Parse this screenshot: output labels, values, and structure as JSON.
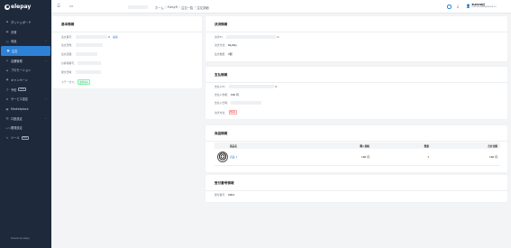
{
  "sidebar": {
    "logo_text": "elepay",
    "items": [
      {
        "icon": "dashboard-icon",
        "glyph": "⊞",
        "label": "ダッシュボード",
        "chevron": false,
        "beta": "",
        "active": false
      },
      {
        "icon": "payment-icon",
        "glyph": "▤",
        "label": "決済",
        "chevron": false,
        "beta": "",
        "active": false
      },
      {
        "icon": "product-icon",
        "glyph": "◫",
        "label": "商品",
        "chevron": true,
        "beta": "",
        "active": false
      },
      {
        "icon": "order-icon",
        "glyph": "▦",
        "label": "注文",
        "chevron": false,
        "beta": "",
        "active": true
      },
      {
        "icon": "store-icon",
        "glyph": "⌂",
        "label": "店舗管理",
        "chevron": true,
        "beta": "",
        "active": false
      },
      {
        "icon": "promotion-icon",
        "glyph": "◈",
        "label": "プロモーション",
        "chevron": false,
        "beta": "",
        "active": false
      },
      {
        "icon": "campaign-icon",
        "glyph": "◉",
        "label": "キャンペーン",
        "chevron": false,
        "beta": "",
        "active": false
      },
      {
        "icon": "booking-icon",
        "glyph": "◷",
        "label": "予約",
        "chevron": false,
        "beta": "Beta",
        "active": false
      },
      {
        "icon": "service-icon",
        "glyph": "⚙",
        "label": "サービス設定",
        "chevron": true,
        "beta": "",
        "active": false
      },
      {
        "icon": "marketplace-icon",
        "glyph": "▣",
        "label": "Marketplace",
        "chevron": false,
        "beta": "",
        "active": false
      },
      {
        "icon": "account-icon",
        "glyph": "▥",
        "label": "口座設定",
        "chevron": true,
        "beta": "",
        "active": false
      },
      {
        "icon": "developer-icon",
        "glyph": "</>",
        "label": "開発設定",
        "chevron": false,
        "beta": "",
        "active": false
      },
      {
        "icon": "tools-icon",
        "glyph": "✎",
        "label": "ツール",
        "chevron": false,
        "beta": "Beta",
        "active": false
      }
    ],
    "powered_by": "Powered by elepay"
  },
  "topbar": {
    "breadcrumbs": [
      "ホーム",
      "ElesyR",
      "注文一覧",
      "注文詳細"
    ],
    "user_name": "ELESYR社",
    "user_email": "ELESYR-DEMO@ELESYR.CO"
  },
  "basic_info": {
    "title": "基本情報",
    "order_no_label": "注文番号：",
    "edit_link": "編集",
    "order_date_label": "注文日時：",
    "store_label": "注文店舗：",
    "customer_label": "お客様番号：",
    "receipt_label": "受付日時：",
    "status_label": "ステータス：",
    "status_value": "受付済み"
  },
  "payment": {
    "title": "決済情報",
    "payment_id_label": "決済ID：",
    "method_label": "決済方法：",
    "method_value": "PayPay",
    "qty_label": "注文数量：",
    "qty_value": "2個"
  },
  "paymentinfo": {
    "title": "支払情報",
    "pay_id_label": "支払いID：",
    "amount_label": "支払い金額：",
    "amount_value": "160 円",
    "datetime_label": "支払い日時：",
    "type_label": "決済方法：",
    "type_value": "Beta"
  },
  "products": {
    "title": "商品情報",
    "headers": [
      "商品名",
      "購入価格",
      "数量",
      "合計金額"
    ],
    "rows": [
      {
        "name": "商品 1",
        "price": "160 円",
        "qty": "1",
        "total": "160 円"
      }
    ]
  },
  "reception": {
    "title": "受付番号情報",
    "number_label": "受付番号：",
    "number_value": "0002"
  },
  "colors": {
    "sidebar": "#1e2a3b",
    "accent": "#2d82d8",
    "background": "#f3f4f6"
  }
}
